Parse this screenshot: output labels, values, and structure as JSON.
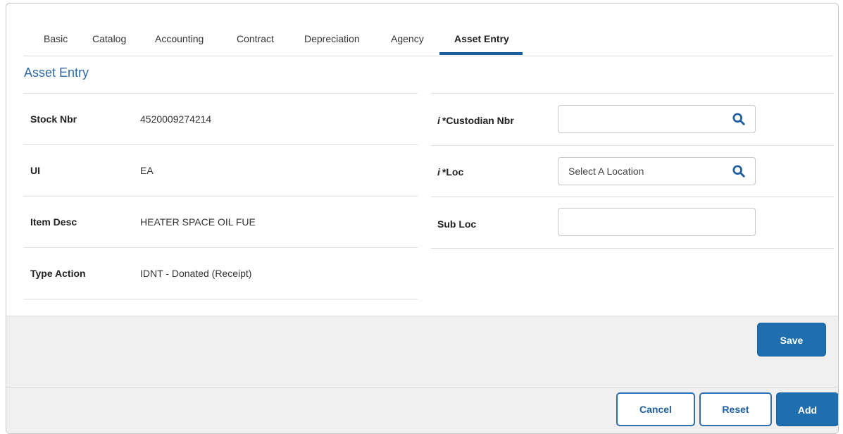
{
  "tabs": [
    {
      "label": "Basic"
    },
    {
      "label": "Catalog"
    },
    {
      "label": "Accounting"
    },
    {
      "label": "Contract"
    },
    {
      "label": "Depreciation"
    },
    {
      "label": "Agency"
    },
    {
      "label": "Asset Entry"
    }
  ],
  "active_tab": "Asset Entry",
  "section": {
    "title": "Asset Entry"
  },
  "left_fields": [
    {
      "label": "Stock Nbr",
      "value": "4520009274214"
    },
    {
      "label": "UI",
      "value": "EA"
    },
    {
      "label": "Item Desc",
      "value": "HEATER SPACE OIL FUE"
    },
    {
      "label": "Type Action",
      "value": "IDNT - Donated (Receipt)"
    }
  ],
  "right_fields": {
    "custodian": {
      "info": "i",
      "label": "*Custodian Nbr",
      "value": ""
    },
    "loc": {
      "info": "i",
      "label": "*Loc",
      "placeholder": "Select A Location"
    },
    "subloc": {
      "label": "Sub Loc",
      "value": ""
    }
  },
  "buttons": {
    "save": "Save",
    "cancel": "Cancel",
    "reset": "Reset",
    "add": "Add"
  },
  "colors": {
    "accent": "#1f6fae",
    "title": "#2f6aa5"
  }
}
